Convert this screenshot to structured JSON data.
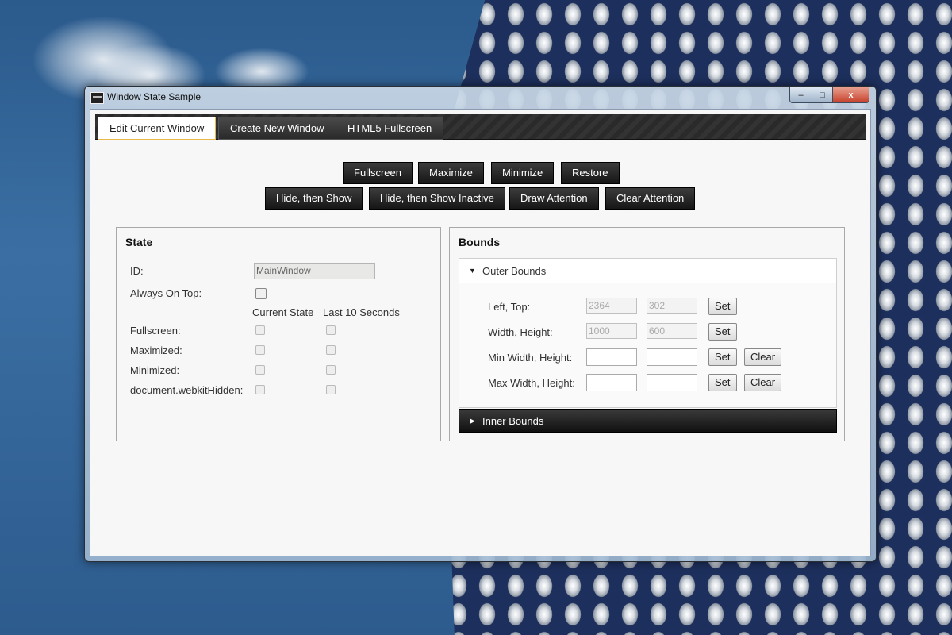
{
  "window": {
    "title": "Window State Sample",
    "controls": {
      "minimize": "–",
      "maximize": "□",
      "close": "x"
    }
  },
  "tabs": [
    {
      "label": "Edit Current Window",
      "active": true
    },
    {
      "label": "Create New Window",
      "active": false
    },
    {
      "label": "HTML5 Fullscreen",
      "active": false
    }
  ],
  "actions": {
    "row1": [
      "Fullscreen",
      "Maximize",
      "Minimize",
      "Restore"
    ],
    "row2": [
      "Hide, then Show",
      "Hide, then Show Inactive",
      "Draw Attention",
      "Clear Attention"
    ]
  },
  "state": {
    "title": "State",
    "id_label": "ID:",
    "id_value": "MainWindow",
    "always_on_top_label": "Always On Top:",
    "col_current": "Current State",
    "col_last10": "Last 10 Seconds",
    "rows": [
      "Fullscreen:",
      "Maximized:",
      "Minimized:",
      "document.webkitHidden:"
    ]
  },
  "bounds": {
    "title": "Bounds",
    "outer_label": "Outer Bounds",
    "inner_label": "Inner Bounds",
    "rows": [
      {
        "label": "Left, Top:",
        "a": "2364",
        "b": "302",
        "set": "Set",
        "clear": ""
      },
      {
        "label": "Width, Height:",
        "a": "1000",
        "b": "600",
        "set": "Set",
        "clear": ""
      },
      {
        "label": "Min Width, Height:",
        "a": "",
        "b": "",
        "set": "Set",
        "clear": "Clear"
      },
      {
        "label": "Max Width, Height:",
        "a": "",
        "b": "",
        "set": "Set",
        "clear": "Clear"
      }
    ]
  },
  "icons": {
    "collapse": "expanded-triangle-icon",
    "expand": "collapsed-triangle-icon",
    "app": "app-window-icon"
  },
  "colors": {
    "active_tab_border": "#e8b84a",
    "dark_button": "#1e1e1e",
    "close_button": "#c7422c"
  }
}
